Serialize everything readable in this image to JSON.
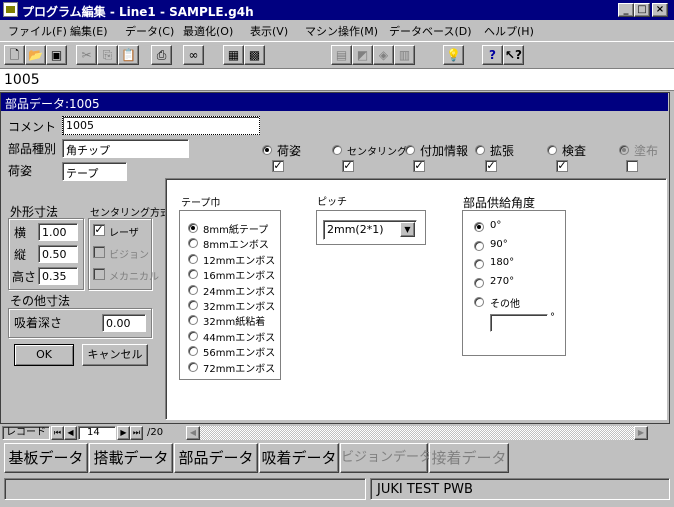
{
  "window": {
    "title": "プログラム編集 - Line1 - SAMPLE.g4h",
    "minimize": "_",
    "maximize": "□",
    "close": "×"
  },
  "menu": [
    "ファイル(F)",
    "編集(E)",
    "データ(C)",
    "最適化(O)",
    "表示(V)",
    "マシン操作(M)",
    "データベース(D)",
    "ヘルプ(H)"
  ],
  "toolbar": {
    "icons": [
      "new-file-icon",
      "open-folder-icon",
      "save-icon",
      "cut-icon",
      "copy-icon",
      "paste-icon",
      "print-icon",
      "glasses-icon",
      "view-a-icon",
      "view-b-icon",
      "tool-1-icon",
      "tool-2-icon",
      "tool-3-icon",
      "tool-4-icon",
      "lightbulb-icon",
      "help-icon",
      "context-help-icon"
    ]
  },
  "record_value": "1005",
  "panel_title": "部品データ:1005",
  "fields": {
    "comment_label": "コメント",
    "comment_value": "1005",
    "part_type_label": "部品種別",
    "part_type_value": "角チップ",
    "package_label": "荷姿",
    "package_value": "テープ"
  },
  "categories": [
    {
      "label": "荷姿",
      "selected": true,
      "checked": true,
      "disabled": false
    },
    {
      "label": "センタリング",
      "selected": false,
      "checked": true,
      "disabled": false
    },
    {
      "label": "付加情報",
      "selected": false,
      "checked": true,
      "disabled": false
    },
    {
      "label": "拡張",
      "selected": false,
      "checked": true,
      "disabled": false
    },
    {
      "label": "検査",
      "selected": false,
      "checked": true,
      "disabled": false
    },
    {
      "label": "塗布",
      "selected": false,
      "checked": false,
      "disabled": true
    }
  ],
  "dimensions": {
    "title": "外形寸法",
    "width_label": "横",
    "width_value": "1.00",
    "length_label": "縦",
    "length_value": "0.50",
    "height_label": "高さ",
    "height_value": "0.35"
  },
  "centering": {
    "title": "センタリング方式",
    "options": [
      {
        "label": "レーザ",
        "checked": true,
        "disabled": false
      },
      {
        "label": "ビジョン",
        "checked": false,
        "disabled": true
      },
      {
        "label": "メカニカル",
        "checked": false,
        "disabled": true
      }
    ]
  },
  "other_dims": {
    "title": "その他寸法",
    "suction_label": "吸着深さ",
    "suction_value": "0.00"
  },
  "buttons": {
    "ok": "OK",
    "cancel": "キャンセル"
  },
  "tape_width": {
    "title": "テープ巾",
    "options": [
      "8mm紙テープ",
      "8mmエンボス",
      "12mmエンボス",
      "16mmエンボス",
      "24mmエンボス",
      "32mmエンボス",
      "32mm紙粘着",
      "44mmエンボス",
      "56mmエンボス",
      "72mmエンボス"
    ],
    "selected": 0
  },
  "pitch": {
    "title": "ピッチ",
    "value": "2mm(2*1)"
  },
  "feed_angle": {
    "title": "部品供給角度",
    "options": [
      "0°",
      "90°",
      "180°",
      "270°",
      "その他"
    ],
    "selected": 0,
    "other_unit": "°"
  },
  "nav": {
    "record_label": "レコード",
    "current": "14",
    "total": "/20"
  },
  "tabs": [
    {
      "label": "基板データ",
      "disabled": false
    },
    {
      "label": "搭載データ",
      "disabled": false
    },
    {
      "label": "部品データ",
      "disabled": false
    },
    {
      "label": "吸着データ",
      "disabled": false
    },
    {
      "label": "ビジョンデータ",
      "disabled": true
    },
    {
      "label": "接着データ",
      "disabled": true
    }
  ],
  "status": {
    "left": "",
    "right": "JUKI TEST PWB"
  },
  "colors": {
    "titlebar": "#000080",
    "face": "#c0c0c0"
  }
}
